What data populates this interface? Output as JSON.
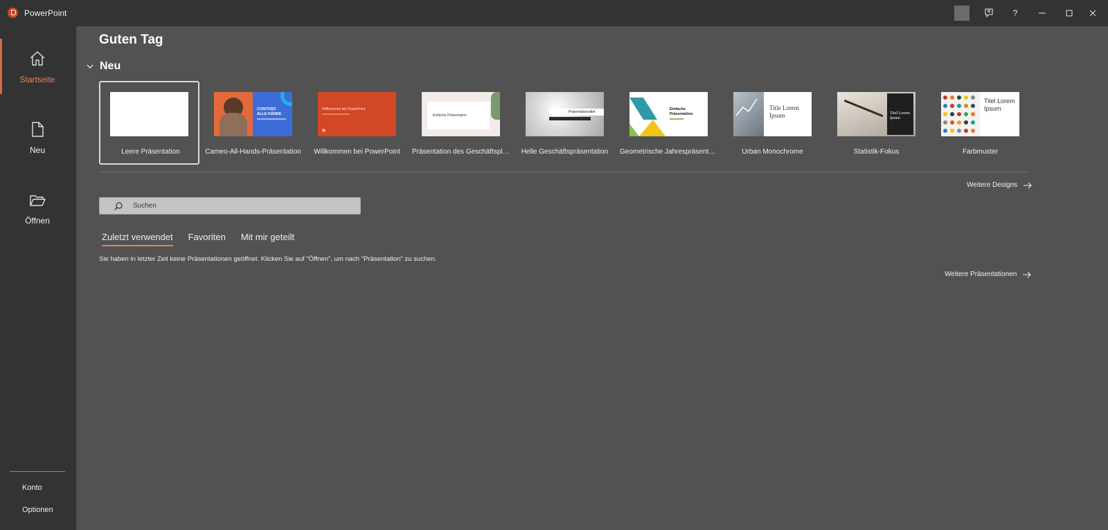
{
  "app": {
    "title": "PowerPoint"
  },
  "titlebar": {
    "buttons": [
      {
        "icon": "feedback-icon"
      },
      {
        "icon": "help-icon",
        "glyph": "?"
      },
      {
        "icon": "minimize-icon"
      },
      {
        "icon": "maximize-icon"
      },
      {
        "icon": "close-icon"
      }
    ]
  },
  "sidebar": {
    "items": [
      {
        "label": "Startseite",
        "icon": "home-icon",
        "active": true
      },
      {
        "label": "Neu",
        "icon": "new-document-icon"
      },
      {
        "label": "Öffnen",
        "icon": "folder-open-icon"
      }
    ],
    "bottom": [
      {
        "label": "Konto"
      },
      {
        "label": "Optionen"
      }
    ]
  },
  "main": {
    "greeting": "Guten Tag",
    "new_section": {
      "title": "Neu",
      "templates": [
        {
          "label": "Leere Präsentation"
        },
        {
          "label": "Cameo-All-Hands-Präsentation",
          "thumb_text": "CONTOSO ALLE HÄNDE"
        },
        {
          "label": "Willkommen bei PowerPoint",
          "thumb_text": "Willkommen bei PowerPoint"
        },
        {
          "label": "Präsentation des Geschäftsplans",
          "thumb_text": "Einfache Präsentation"
        },
        {
          "label": "Helle Geschäftspräsentation",
          "thumb_text": "Präsentationstitel"
        },
        {
          "label": "Geometrische Jahrespräsentation",
          "thumb_text": "Einfache Präsentation"
        },
        {
          "label": "Urban Monochrome",
          "thumb_text": "Title Lorem Ipsum"
        },
        {
          "label": "Statistik-Fokus",
          "thumb_text": "Titel Lorem Ipsum"
        },
        {
          "label": "Farbmuster",
          "thumb_text": "Titel Lorem Ipsum"
        }
      ],
      "more_designs": "Weitere Designs"
    },
    "search": {
      "placeholder": "Suchen"
    },
    "tabs": [
      {
        "label": "Zuletzt verwendet",
        "active": true
      },
      {
        "label": "Favoriten"
      },
      {
        "label": "Mit mir geteilt"
      }
    ],
    "empty_message": "Sie haben in letzter Zeit keine Präsentationen geöffnet. Klicken Sie auf \"Öffnen\", um nach \"Präsentation\" zu suchen.",
    "more_presentations": "Weitere Präsentationen"
  },
  "colors": {
    "accent": "#e8845a",
    "background": "#525252",
    "sidebar": "#333333"
  }
}
